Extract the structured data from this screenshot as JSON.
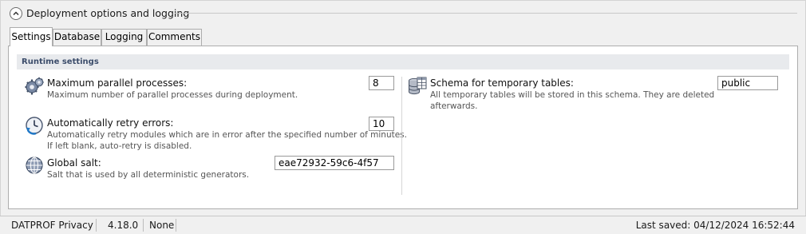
{
  "section": {
    "title": "Deployment options and logging"
  },
  "tabs": [
    {
      "label": "Settings"
    },
    {
      "label": "Database"
    },
    {
      "label": "Logging"
    },
    {
      "label": "Comments"
    }
  ],
  "active_tab": "Settings",
  "group": {
    "title": "Runtime settings"
  },
  "settings": {
    "max_parallel": {
      "label": "Maximum parallel processes:",
      "description": "Maximum number of parallel processes during deployment.",
      "value": "8",
      "icon": "gears-icon"
    },
    "retry": {
      "label": "Automatically retry errors:",
      "description_line1": "Automatically retry modules which are in error after the specified number of minutes.",
      "description_line2": "If left blank, auto-retry is disabled.",
      "value": "10",
      "icon": "clock-retry-icon"
    },
    "global_salt": {
      "label": "Global salt:",
      "description": "Salt that is used by all deterministic generators.",
      "value": "eae72932-59c6-4f57",
      "icon": "globe-icon"
    },
    "schema": {
      "label": "Schema for temporary tables:",
      "description_line1": "All temporary tables will be stored in this schema. They are deleted",
      "description_line2": "afterwards.",
      "value": "public",
      "icon": "database-table-icon"
    }
  },
  "status_bar": {
    "product": "DATPROF Privacy",
    "version": "4.18.0",
    "connection": "None",
    "last_saved": "Last saved: 04/12/2024 16:52:44"
  }
}
